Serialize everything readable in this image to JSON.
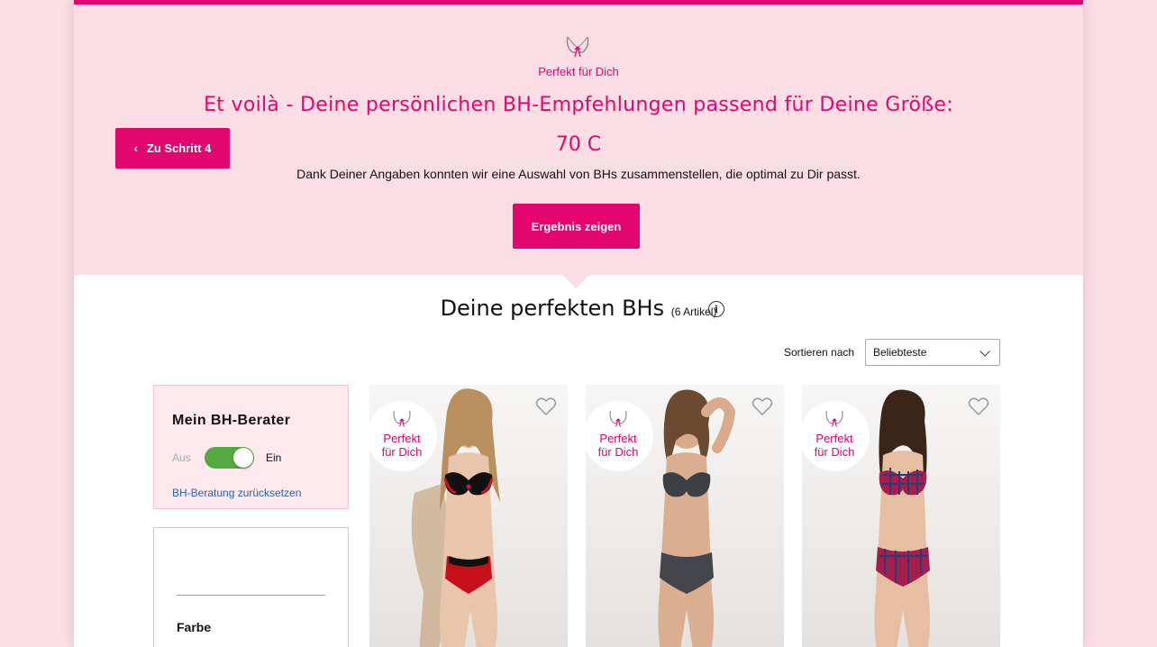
{
  "hero": {
    "small_title": "Perfekt für Dich",
    "headline": "Et voilà - Deine persönlichen BH-Empfehlungen passend für Deine Größe:",
    "size": "70 C",
    "description": "Dank Deiner Angaben konnten wir eine Auswahl von BHs zusammenstellen, die optimal zu Dir passt.",
    "back_button": "Zu Schritt 4",
    "result_button": "Ergebnis zeigen"
  },
  "section": {
    "title": "Deine perfekten BHs",
    "count": "(6 Artikel)",
    "info_icon": "info-icon"
  },
  "sort": {
    "label": "Sortieren nach",
    "selected": "Beliebteste"
  },
  "advisor": {
    "title": "Mein BH-Berater",
    "toggle_off": "Aus",
    "toggle_on": "Ein",
    "toggle_state": "on",
    "reset_link": "BH-Beratung zurücksetzen"
  },
  "filter": {
    "title": "Farbe"
  },
  "products": [
    {
      "badge_line1": "Perfekt",
      "badge_line2": "für Dich",
      "icon": "heart-icon",
      "bra_color": "black-red"
    },
    {
      "badge_line1": "Perfekt",
      "badge_line2": "für Dich",
      "icon": "heart-icon",
      "bra_color": "grey"
    },
    {
      "badge_line1": "Perfekt",
      "badge_line2": "für Dich",
      "icon": "heart-icon",
      "bra_color": "plaid-red-blue"
    }
  ],
  "colors": {
    "brand_pink": "#e2066e",
    "hero_bg": "#fbdde5",
    "toggle_green": "#53a93f",
    "link_blue": "#2a64b4"
  }
}
